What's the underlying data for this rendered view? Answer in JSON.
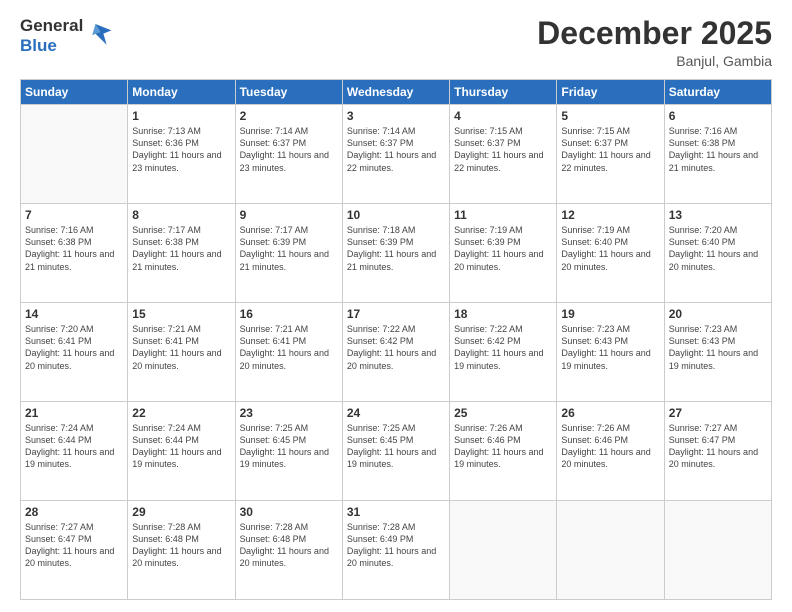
{
  "logo": {
    "general": "General",
    "blue": "Blue"
  },
  "header": {
    "month": "December 2025",
    "location": "Banjul, Gambia"
  },
  "weekdays": [
    "Sunday",
    "Monday",
    "Tuesday",
    "Wednesday",
    "Thursday",
    "Friday",
    "Saturday"
  ],
  "weeks": [
    [
      {
        "day": "",
        "sunrise": "",
        "sunset": "",
        "daylight": ""
      },
      {
        "day": "1",
        "sunrise": "Sunrise: 7:13 AM",
        "sunset": "Sunset: 6:36 PM",
        "daylight": "Daylight: 11 hours and 23 minutes."
      },
      {
        "day": "2",
        "sunrise": "Sunrise: 7:14 AM",
        "sunset": "Sunset: 6:37 PM",
        "daylight": "Daylight: 11 hours and 23 minutes."
      },
      {
        "day": "3",
        "sunrise": "Sunrise: 7:14 AM",
        "sunset": "Sunset: 6:37 PM",
        "daylight": "Daylight: 11 hours and 22 minutes."
      },
      {
        "day": "4",
        "sunrise": "Sunrise: 7:15 AM",
        "sunset": "Sunset: 6:37 PM",
        "daylight": "Daylight: 11 hours and 22 minutes."
      },
      {
        "day": "5",
        "sunrise": "Sunrise: 7:15 AM",
        "sunset": "Sunset: 6:37 PM",
        "daylight": "Daylight: 11 hours and 22 minutes."
      },
      {
        "day": "6",
        "sunrise": "Sunrise: 7:16 AM",
        "sunset": "Sunset: 6:38 PM",
        "daylight": "Daylight: 11 hours and 21 minutes."
      }
    ],
    [
      {
        "day": "7",
        "sunrise": "Sunrise: 7:16 AM",
        "sunset": "Sunset: 6:38 PM",
        "daylight": "Daylight: 11 hours and 21 minutes."
      },
      {
        "day": "8",
        "sunrise": "Sunrise: 7:17 AM",
        "sunset": "Sunset: 6:38 PM",
        "daylight": "Daylight: 11 hours and 21 minutes."
      },
      {
        "day": "9",
        "sunrise": "Sunrise: 7:17 AM",
        "sunset": "Sunset: 6:39 PM",
        "daylight": "Daylight: 11 hours and 21 minutes."
      },
      {
        "day": "10",
        "sunrise": "Sunrise: 7:18 AM",
        "sunset": "Sunset: 6:39 PM",
        "daylight": "Daylight: 11 hours and 21 minutes."
      },
      {
        "day": "11",
        "sunrise": "Sunrise: 7:19 AM",
        "sunset": "Sunset: 6:39 PM",
        "daylight": "Daylight: 11 hours and 20 minutes."
      },
      {
        "day": "12",
        "sunrise": "Sunrise: 7:19 AM",
        "sunset": "Sunset: 6:40 PM",
        "daylight": "Daylight: 11 hours and 20 minutes."
      },
      {
        "day": "13",
        "sunrise": "Sunrise: 7:20 AM",
        "sunset": "Sunset: 6:40 PM",
        "daylight": "Daylight: 11 hours and 20 minutes."
      }
    ],
    [
      {
        "day": "14",
        "sunrise": "Sunrise: 7:20 AM",
        "sunset": "Sunset: 6:41 PM",
        "daylight": "Daylight: 11 hours and 20 minutes."
      },
      {
        "day": "15",
        "sunrise": "Sunrise: 7:21 AM",
        "sunset": "Sunset: 6:41 PM",
        "daylight": "Daylight: 11 hours and 20 minutes."
      },
      {
        "day": "16",
        "sunrise": "Sunrise: 7:21 AM",
        "sunset": "Sunset: 6:41 PM",
        "daylight": "Daylight: 11 hours and 20 minutes."
      },
      {
        "day": "17",
        "sunrise": "Sunrise: 7:22 AM",
        "sunset": "Sunset: 6:42 PM",
        "daylight": "Daylight: 11 hours and 20 minutes."
      },
      {
        "day": "18",
        "sunrise": "Sunrise: 7:22 AM",
        "sunset": "Sunset: 6:42 PM",
        "daylight": "Daylight: 11 hours and 19 minutes."
      },
      {
        "day": "19",
        "sunrise": "Sunrise: 7:23 AM",
        "sunset": "Sunset: 6:43 PM",
        "daylight": "Daylight: 11 hours and 19 minutes."
      },
      {
        "day": "20",
        "sunrise": "Sunrise: 7:23 AM",
        "sunset": "Sunset: 6:43 PM",
        "daylight": "Daylight: 11 hours and 19 minutes."
      }
    ],
    [
      {
        "day": "21",
        "sunrise": "Sunrise: 7:24 AM",
        "sunset": "Sunset: 6:44 PM",
        "daylight": "Daylight: 11 hours and 19 minutes."
      },
      {
        "day": "22",
        "sunrise": "Sunrise: 7:24 AM",
        "sunset": "Sunset: 6:44 PM",
        "daylight": "Daylight: 11 hours and 19 minutes."
      },
      {
        "day": "23",
        "sunrise": "Sunrise: 7:25 AM",
        "sunset": "Sunset: 6:45 PM",
        "daylight": "Daylight: 11 hours and 19 minutes."
      },
      {
        "day": "24",
        "sunrise": "Sunrise: 7:25 AM",
        "sunset": "Sunset: 6:45 PM",
        "daylight": "Daylight: 11 hours and 19 minutes."
      },
      {
        "day": "25",
        "sunrise": "Sunrise: 7:26 AM",
        "sunset": "Sunset: 6:46 PM",
        "daylight": "Daylight: 11 hours and 19 minutes."
      },
      {
        "day": "26",
        "sunrise": "Sunrise: 7:26 AM",
        "sunset": "Sunset: 6:46 PM",
        "daylight": "Daylight: 11 hours and 20 minutes."
      },
      {
        "day": "27",
        "sunrise": "Sunrise: 7:27 AM",
        "sunset": "Sunset: 6:47 PM",
        "daylight": "Daylight: 11 hours and 20 minutes."
      }
    ],
    [
      {
        "day": "28",
        "sunrise": "Sunrise: 7:27 AM",
        "sunset": "Sunset: 6:47 PM",
        "daylight": "Daylight: 11 hours and 20 minutes."
      },
      {
        "day": "29",
        "sunrise": "Sunrise: 7:28 AM",
        "sunset": "Sunset: 6:48 PM",
        "daylight": "Daylight: 11 hours and 20 minutes."
      },
      {
        "day": "30",
        "sunrise": "Sunrise: 7:28 AM",
        "sunset": "Sunset: 6:48 PM",
        "daylight": "Daylight: 11 hours and 20 minutes."
      },
      {
        "day": "31",
        "sunrise": "Sunrise: 7:28 AM",
        "sunset": "Sunset: 6:49 PM",
        "daylight": "Daylight: 11 hours and 20 minutes."
      },
      {
        "day": "",
        "sunrise": "",
        "sunset": "",
        "daylight": ""
      },
      {
        "day": "",
        "sunrise": "",
        "sunset": "",
        "daylight": ""
      },
      {
        "day": "",
        "sunrise": "",
        "sunset": "",
        "daylight": ""
      }
    ]
  ]
}
